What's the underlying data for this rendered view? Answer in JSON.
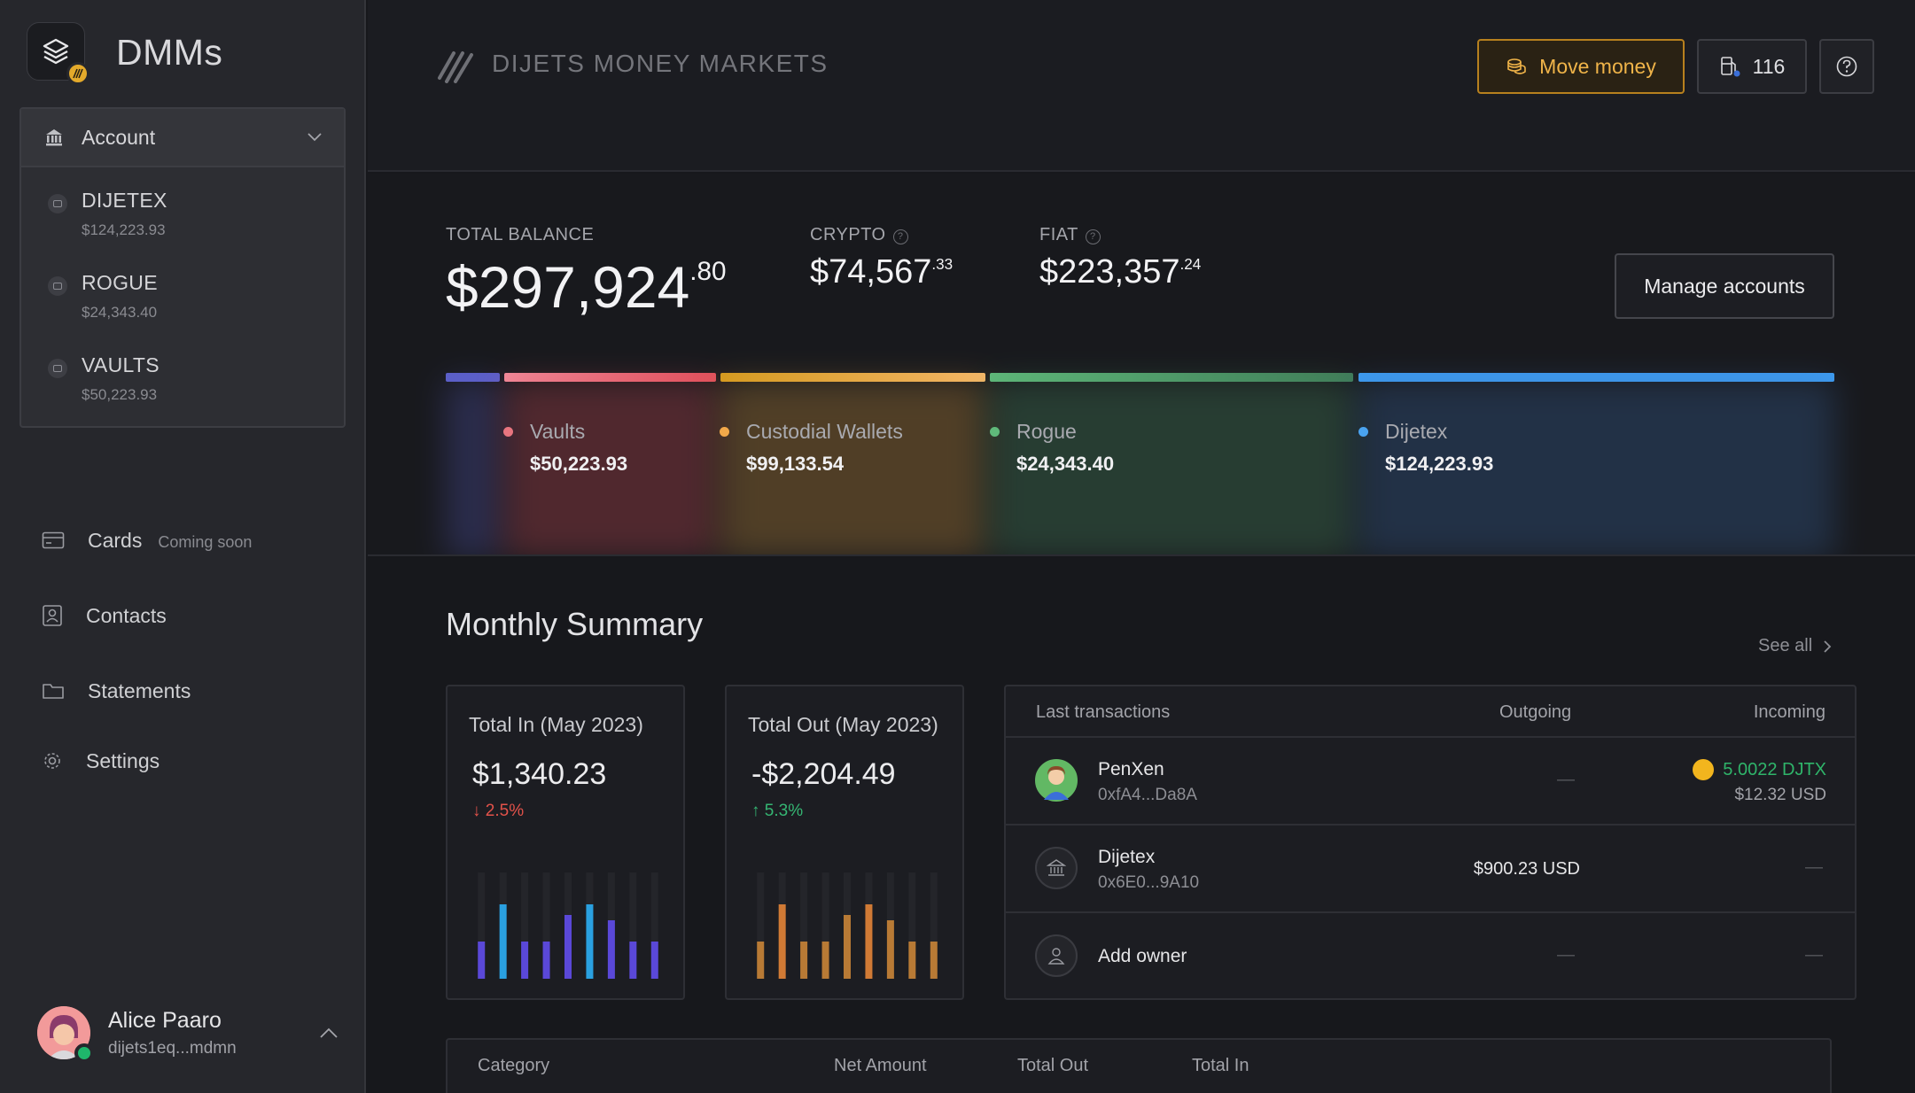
{
  "app": {
    "brand": "DMMs"
  },
  "sidebar": {
    "account_label": "Account",
    "accounts": [
      {
        "name": "DIJETEX",
        "amount": "$124,223.93"
      },
      {
        "name": "ROGUE",
        "amount": "$24,343.40"
      },
      {
        "name": "VAULTS",
        "amount": "$50,223.93"
      }
    ],
    "nav": [
      {
        "label": "Cards",
        "badge": "Coming soon",
        "icon": "card-icon"
      },
      {
        "label": "Contacts",
        "icon": "contacts-icon"
      },
      {
        "label": "Statements",
        "icon": "folder-icon"
      },
      {
        "label": "Settings",
        "icon": "gear-icon"
      }
    ],
    "user": {
      "name": "Alice Paaro",
      "address": "dijets1eq...mdmn"
    }
  },
  "header": {
    "title": "DIJETS MONEY MARKETS",
    "move_money": "Move money",
    "notif_count": "116"
  },
  "balances": {
    "total_label": "TOTAL BALANCE",
    "total_main": "$297,924",
    "total_cents": ".80",
    "crypto_label": "CRYPTO",
    "crypto_main": "$74,567",
    "crypto_cents": ".33",
    "fiat_label": "FIAT",
    "fiat_main": "$223,357",
    "fiat_cents": ".24",
    "manage": "Manage accounts"
  },
  "distribution": [
    {
      "name": "Vaults",
      "amount": "$50,223.93",
      "color": "#e8757f"
    },
    {
      "name": "Custodial Wallets",
      "amount": "$99,133.54",
      "color": "#f2a94a"
    },
    {
      "name": "Rogue",
      "amount": "$24,343.40",
      "color": "#5fb97a"
    },
    {
      "name": "Dijetex",
      "amount": "$124,223.93",
      "color": "#4aa3f0"
    }
  ],
  "summary": {
    "title": "Monthly Summary",
    "see_all": "See all",
    "total_in": {
      "label": "Total In (May 2023)",
      "value": "$1,340.23",
      "change": "↓ 2.5%",
      "bars": [
        0.35,
        0.7,
        0.35,
        0.35,
        0.6,
        0.7,
        0.55,
        0.35,
        0.35
      ]
    },
    "total_out": {
      "label": "Total Out (May 2023)",
      "value": "-$2,204.49",
      "change": "↑ 5.3%",
      "bars": [
        0.35,
        0.7,
        0.35,
        0.35,
        0.6,
        0.7,
        0.55,
        0.35,
        0.35
      ]
    }
  },
  "transactions": {
    "headers": {
      "name": "Last transactions",
      "out": "Outgoing",
      "in": "Incoming"
    },
    "rows": [
      {
        "name": "PenXen",
        "addr": "0xfA4...Da8A",
        "out": "—",
        "in_token": "5.0022 DJTX",
        "in_usd": "$12.32 USD"
      },
      {
        "name": "Dijetex",
        "addr": "0x6E0...9A10",
        "out": "$900.23 USD",
        "in": "—"
      },
      {
        "name": "Add owner",
        "out": "—",
        "in": "—"
      }
    ]
  },
  "category_table": {
    "headers": [
      "Category",
      "Net Amount",
      "Total Out",
      "Total In"
    ]
  }
}
